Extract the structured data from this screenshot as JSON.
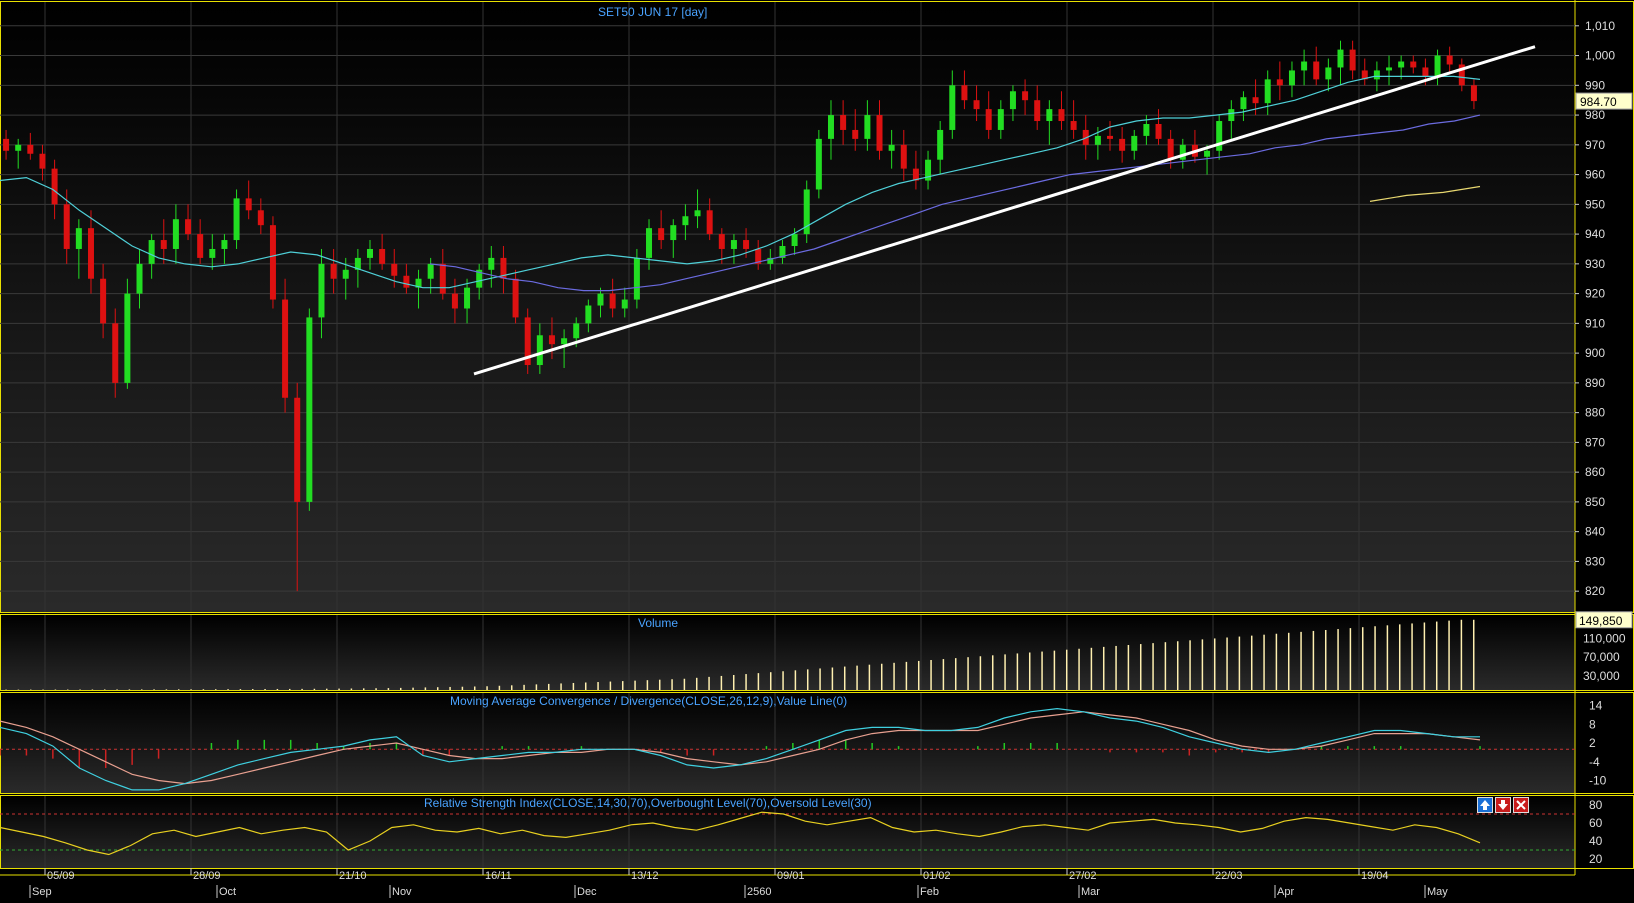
{
  "chart_data": [
    {
      "type": "candlestick",
      "title": "SET50 JUN 17   [day]",
      "ylim": [
        813,
        1018
      ],
      "y_ticks": [
        "1,010",
        "1,000",
        "990",
        "980",
        "970",
        "960",
        "950",
        "940",
        "930",
        "920",
        "910",
        "900",
        "890",
        "880",
        "870",
        "860",
        "850",
        "840",
        "830",
        "820"
      ],
      "last_price": "984.70",
      "colors": {
        "up": "#22dd22",
        "down": "#dd1111",
        "ma_fast": "#4fd0d8",
        "ma_slow": "#6b6be0",
        "ma_long": "#e8d870",
        "trendline": "#ffffff"
      },
      "x_ticks_top": [
        "05/09",
        "28/09",
        "21/10",
        "16/11",
        "13/12",
        "09/01",
        "01/02",
        "27/02",
        "22/03",
        "19/04"
      ],
      "x_ticks_bottom": [
        "Sep",
        "Oct",
        "Nov",
        "Dec",
        "2560",
        "Feb",
        "Mar",
        "Apr",
        "May"
      ],
      "trendline": {
        "from": 893,
        "to": 1003
      },
      "candles": [
        [
          972,
          975,
          965,
          968
        ],
        [
          968,
          972,
          962,
          970
        ],
        [
          970,
          974,
          965,
          967
        ],
        [
          967,
          970,
          958,
          962
        ],
        [
          962,
          965,
          945,
          950
        ],
        [
          950,
          955,
          930,
          935
        ],
        [
          935,
          945,
          925,
          942
        ],
        [
          942,
          948,
          920,
          925
        ],
        [
          925,
          930,
          905,
          910
        ],
        [
          910,
          915,
          885,
          890
        ],
        [
          890,
          925,
          888,
          920
        ],
        [
          920,
          935,
          915,
          930
        ],
        [
          930,
          940,
          925,
          938
        ],
        [
          938,
          945,
          930,
          935
        ],
        [
          935,
          950,
          930,
          945
        ],
        [
          945,
          950,
          938,
          940
        ],
        [
          940,
          945,
          930,
          932
        ],
        [
          932,
          940,
          928,
          935
        ],
        [
          935,
          940,
          930,
          938
        ],
        [
          938,
          955,
          935,
          952
        ],
        [
          952,
          958,
          945,
          948
        ],
        [
          948,
          952,
          940,
          943
        ],
        [
          943,
          946,
          915,
          918
        ],
        [
          918,
          925,
          880,
          885
        ],
        [
          885,
          890,
          820,
          850
        ],
        [
          850,
          915,
          847,
          912
        ],
        [
          912,
          935,
          905,
          930
        ],
        [
          930,
          935,
          920,
          925
        ],
        [
          925,
          932,
          918,
          928
        ],
        [
          928,
          935,
          922,
          932
        ],
        [
          932,
          938,
          928,
          935
        ],
        [
          935,
          940,
          928,
          930
        ],
        [
          930,
          935,
          922,
          926
        ],
        [
          926,
          930,
          920,
          922
        ],
        [
          922,
          928,
          915,
          925
        ],
        [
          925,
          932,
          920,
          930
        ],
        [
          930,
          935,
          918,
          920
        ],
        [
          920,
          925,
          910,
          915
        ],
        [
          915,
          925,
          910,
          922
        ],
        [
          922,
          930,
          918,
          928
        ],
        [
          928,
          936,
          922,
          932
        ],
        [
          932,
          936,
          920,
          925
        ],
        [
          925,
          928,
          910,
          912
        ],
        [
          912,
          915,
          893,
          896
        ],
        [
          896,
          910,
          893,
          906
        ],
        [
          906,
          912,
          898,
          903
        ],
        [
          903,
          908,
          895,
          905
        ],
        [
          905,
          912,
          902,
          910
        ],
        [
          910,
          918,
          907,
          916
        ],
        [
          916,
          922,
          912,
          920
        ],
        [
          920,
          925,
          912,
          915
        ],
        [
          915,
          922,
          912,
          918
        ],
        [
          918,
          935,
          915,
          932
        ],
        [
          932,
          945,
          928,
          942
        ],
        [
          942,
          948,
          935,
          938
        ],
        [
          938,
          945,
          932,
          943
        ],
        [
          943,
          950,
          938,
          946
        ],
        [
          946,
          955,
          942,
          948
        ],
        [
          948,
          952,
          938,
          940
        ],
        [
          940,
          942,
          930,
          935
        ],
        [
          935,
          940,
          930,
          938
        ],
        [
          938,
          942,
          932,
          935
        ],
        [
          935,
          938,
          928,
          930
        ],
        [
          930,
          935,
          928,
          932
        ],
        [
          932,
          938,
          930,
          936
        ],
        [
          936,
          942,
          933,
          940
        ],
        [
          940,
          958,
          937,
          955
        ],
        [
          955,
          975,
          952,
          972
        ],
        [
          972,
          985,
          965,
          980
        ],
        [
          980,
          985,
          970,
          975
        ],
        [
          975,
          982,
          968,
          972
        ],
        [
          972,
          985,
          968,
          980
        ],
        [
          980,
          985,
          965,
          968
        ],
        [
          968,
          975,
          962,
          970
        ],
        [
          970,
          975,
          958,
          962
        ],
        [
          962,
          968,
          955,
          958
        ],
        [
          958,
          968,
          955,
          965
        ],
        [
          965,
          978,
          960,
          975
        ],
        [
          975,
          995,
          972,
          990
        ],
        [
          990,
          995,
          982,
          985
        ],
        [
          985,
          990,
          978,
          982
        ],
        [
          982,
          988,
          972,
          975
        ],
        [
          975,
          985,
          972,
          982
        ],
        [
          982,
          990,
          978,
          988
        ],
        [
          988,
          992,
          980,
          985
        ],
        [
          985,
          990,
          975,
          978
        ],
        [
          978,
          985,
          970,
          982
        ],
        [
          982,
          988,
          975,
          978
        ],
        [
          978,
          985,
          972,
          975
        ],
        [
          975,
          980,
          965,
          970
        ],
        [
          970,
          976,
          965,
          973
        ],
        [
          973,
          978,
          968,
          972
        ],
        [
          972,
          976,
          964,
          968
        ],
        [
          968,
          975,
          965,
          973
        ],
        [
          973,
          980,
          970,
          977
        ],
        [
          977,
          982,
          970,
          972
        ],
        [
          972,
          975,
          962,
          965
        ],
        [
          965,
          972,
          962,
          970
        ],
        [
          970,
          975,
          964,
          966
        ],
        [
          966,
          970,
          960,
          968
        ],
        [
          968,
          980,
          965,
          978
        ],
        [
          978,
          985,
          972,
          982
        ],
        [
          982,
          988,
          978,
          986
        ],
        [
          986,
          992,
          980,
          984
        ],
        [
          984,
          995,
          980,
          992
        ],
        [
          992,
          998,
          985,
          990
        ],
        [
          990,
          998,
          986,
          995
        ],
        [
          995,
          1002,
          990,
          998
        ],
        [
          998,
          1003,
          990,
          992
        ],
        [
          992,
          999,
          988,
          996
        ],
        [
          996,
          1005,
          990,
          1002
        ],
        [
          1002,
          1005,
          992,
          995
        ],
        [
          995,
          999,
          990,
          992
        ],
        [
          992,
          998,
          988,
          995
        ],
        [
          995,
          1000,
          990,
          996
        ],
        [
          996,
          1000,
          992,
          998
        ],
        [
          998,
          1000,
          994,
          996
        ],
        [
          996,
          999,
          990,
          993
        ],
        [
          993,
          1002,
          990,
          1000
        ],
        [
          1000,
          1003,
          994,
          997
        ],
        [
          997,
          999,
          988,
          990
        ],
        [
          990,
          992,
          982,
          984.7
        ]
      ],
      "ma_fast": [
        958,
        959,
        955,
        948,
        942,
        936,
        932,
        930,
        929,
        930,
        932,
        934,
        933,
        930,
        927,
        924,
        922,
        922,
        924,
        926,
        928,
        930,
        932,
        933,
        932,
        931,
        930,
        931,
        933,
        936,
        940,
        945,
        950,
        954,
        957,
        959,
        961,
        963,
        965,
        967,
        969,
        972,
        976,
        978,
        979,
        979,
        980,
        981,
        983,
        985,
        988,
        991,
        993,
        993,
        993,
        993,
        992
      ],
      "ma_slow": [
        930,
        929,
        927,
        925,
        924,
        922,
        921,
        921,
        922,
        923,
        925,
        927,
        929,
        931,
        933,
        935,
        938,
        941,
        944,
        947,
        950,
        952,
        954,
        956,
        958,
        960,
        961,
        962,
        963,
        964,
        965,
        966,
        967,
        969,
        970,
        972,
        973,
        974,
        975,
        977,
        978,
        980
      ],
      "ma_long": [
        951,
        953,
        954,
        956
      ],
      "volume": {
        "title": "Volume",
        "last": "149,850",
        "y_ticks": [
          "110,000",
          "70,000",
          "30,000"
        ],
        "values": [
          800,
          800,
          900,
          900,
          1000,
          1000,
          1100,
          1100,
          1200,
          1200,
          1300,
          1300,
          1400,
          1400,
          1500,
          1500,
          1600,
          1700,
          1800,
          1900,
          2000,
          2100,
          2200,
          2300,
          2400,
          2600,
          2800,
          3000,
          3200,
          3500,
          3800,
          4100,
          4500,
          5000,
          5500,
          6000,
          6500,
          7000,
          7500,
          8000,
          9000,
          10000,
          11000,
          12000,
          13000,
          14000,
          15000,
          16000,
          17000,
          18000,
          19000,
          20000,
          21000,
          22000,
          23000,
          24000,
          26000,
          28000,
          30000,
          32000,
          34000,
          36000,
          38000,
          40000,
          42000,
          44000,
          46000,
          48000,
          50000,
          52000,
          54000,
          56000,
          58000,
          60000,
          62000,
          64000,
          66000,
          68000,
          70000,
          72000,
          74000,
          76000,
          78000,
          80000,
          82000,
          84000,
          86000,
          88000,
          90000,
          92000,
          94000,
          96000,
          98000,
          100000,
          102000,
          104000,
          106000,
          108000,
          110000,
          112000,
          114000,
          116000,
          118000,
          120000,
          122000,
          124000,
          126000,
          128000,
          130000,
          132000,
          134000,
          136000,
          138000,
          140000,
          142000,
          144000,
          146000,
          148000,
          149850,
          149850
        ]
      },
      "macd": {
        "title": "Moving Average Convergence / Divergence(CLOSE,26,12,9),Value Line(0)",
        "y_ticks": [
          "14",
          "8",
          "2",
          "-4",
          "-10"
        ],
        "macd_line": [
          7,
          5,
          1,
          -6,
          -10,
          -13,
          -13,
          -11,
          -8,
          -5,
          -3,
          -1,
          0,
          1,
          3,
          4,
          -2,
          -4,
          -3,
          -2,
          -1,
          -1,
          0,
          0,
          0,
          -2,
          -5,
          -6,
          -5,
          -3,
          0,
          3,
          6,
          7,
          7,
          6,
          6,
          7,
          10,
          12,
          13,
          12,
          10,
          9,
          7,
          4,
          2,
          0,
          -1,
          0,
          2,
          4,
          6,
          6,
          5,
          4,
          4
        ],
        "signal_line": [
          9,
          7,
          4,
          0,
          -4,
          -8,
          -10,
          -11,
          -10,
          -8,
          -6,
          -4,
          -2,
          0,
          1,
          2,
          0,
          -2,
          -3,
          -3,
          -2,
          -1,
          -1,
          0,
          0,
          -1,
          -3,
          -4,
          -5,
          -4,
          -2,
          0,
          3,
          5,
          6,
          6,
          6,
          6,
          8,
          10,
          11,
          12,
          11,
          10,
          8,
          6,
          3,
          1,
          0,
          0,
          1,
          3,
          5,
          5,
          5,
          4,
          3
        ]
      },
      "rsi": {
        "title": "Relative Strength Index(CLOSE,14,30,70),Overbought Level(70),Oversold Level(30)",
        "y_ticks": [
          "80",
          "60",
          "40",
          "20"
        ],
        "levels": [
          70,
          30
        ],
        "values": [
          55,
          50,
          45,
          38,
          30,
          25,
          35,
          48,
          52,
          45,
          50,
          55,
          48,
          52,
          55,
          50,
          30,
          40,
          55,
          58,
          52,
          50,
          54,
          48,
          52,
          46,
          44,
          48,
          52,
          58,
          60,
          55,
          52,
          58,
          65,
          72,
          70,
          62,
          58,
          62,
          66,
          55,
          50,
          52,
          48,
          45,
          50,
          56,
          58,
          55,
          52,
          60,
          62,
          64,
          60,
          58,
          55,
          50,
          54,
          62,
          66,
          64,
          60,
          56,
          52,
          58,
          55,
          48,
          38
        ]
      }
    }
  ]
}
